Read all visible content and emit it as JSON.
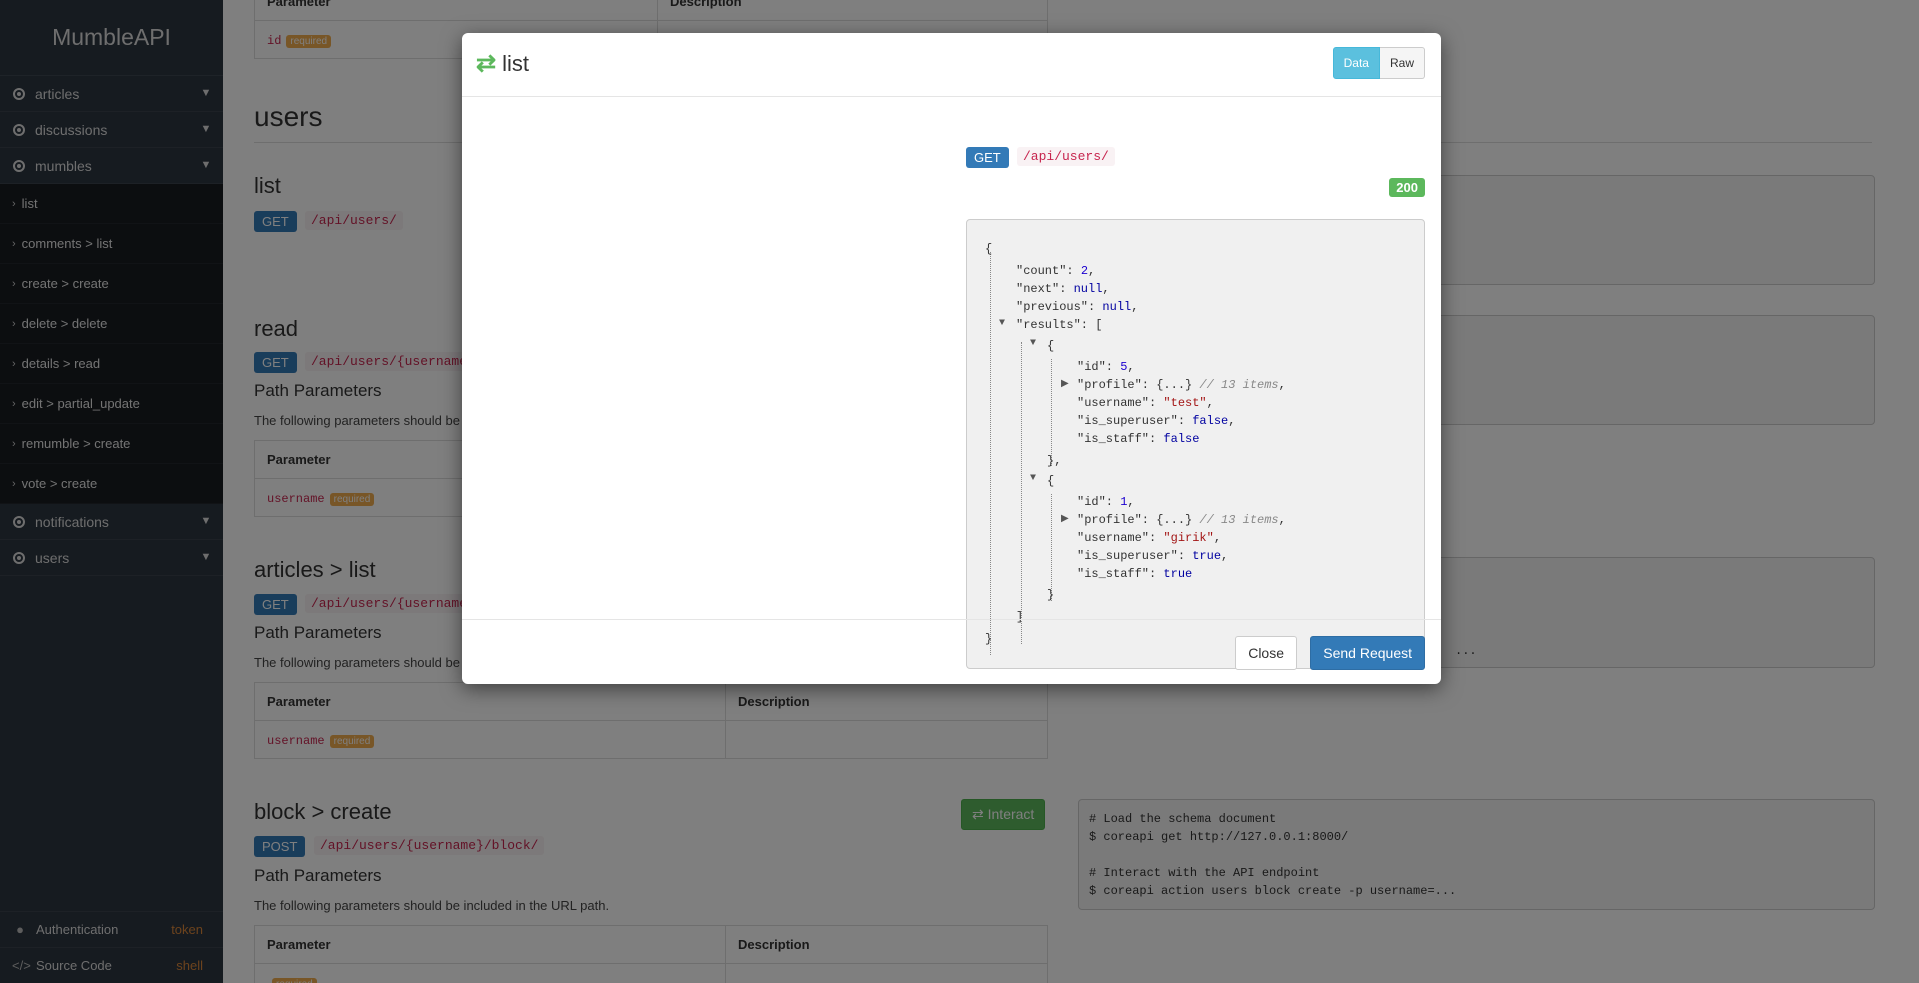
{
  "sidebar": {
    "brand": "MumbleAPI",
    "sections": [
      "articles",
      "discussions",
      "mumbles"
    ],
    "subitems": [
      "list",
      "comments > list",
      "create > create",
      "delete > delete",
      "details > read",
      "edit > partial_update",
      "remumble > create",
      "vote > create"
    ],
    "sections2": [
      "notifications",
      "users"
    ],
    "footer": [
      {
        "label": "Authentication",
        "tag": "token"
      },
      {
        "label": "Source Code",
        "tag": "shell"
      }
    ]
  },
  "main": {
    "table_header": {
      "param": "Parameter",
      "desc": "Description"
    },
    "id_param": "id",
    "required": "required",
    "users_heading": "users",
    "list": {
      "title": "list",
      "method": "GET",
      "path": "/api/users/"
    },
    "read": {
      "title": "read",
      "method": "GET",
      "path": "/api/users/{username}/",
      "path_params": "Path Parameters",
      "note": "The following parameters should be included in the URL path.",
      "param": "username"
    },
    "articles_list": {
      "title": "articles > list",
      "method": "GET",
      "path": "/api/users/{username}/articles/",
      "path_params": "Path Parameters",
      "note": "The following parameters should be included in the URL path.",
      "param": "username"
    },
    "block_create": {
      "title": "block > create",
      "method": "POST",
      "path": "/api/users/{username}/block/",
      "path_params": "Path Parameters",
      "note": "The following parameters should be included in the URL path.",
      "interact": "Interact"
    },
    "code": {
      "line1": "# Load the schema document",
      "line2": "$ coreapi get http://127.0.0.1:8000/",
      "line3": "# Interact with the API endpoint",
      "line4": "$ coreapi action users block create -p username=..."
    },
    "ellipsis": "..."
  },
  "modal": {
    "title": "list",
    "toggle_data": "Data",
    "toggle_raw": "Raw",
    "method": "GET",
    "path": "/api/users/",
    "status": "200",
    "close": "Close",
    "send": "Send Request",
    "json": {
      "count": "2",
      "next": "null",
      "previous": "null",
      "r1": {
        "id": "5",
        "profile_comment": "// 13 items",
        "username": "\"test\"",
        "is_superuser": "false",
        "is_staff": "false"
      },
      "r2": {
        "id": "1",
        "profile_comment": "// 13 items",
        "username": "\"girik\"",
        "is_superuser": "true",
        "is_staff": "true"
      }
    }
  }
}
